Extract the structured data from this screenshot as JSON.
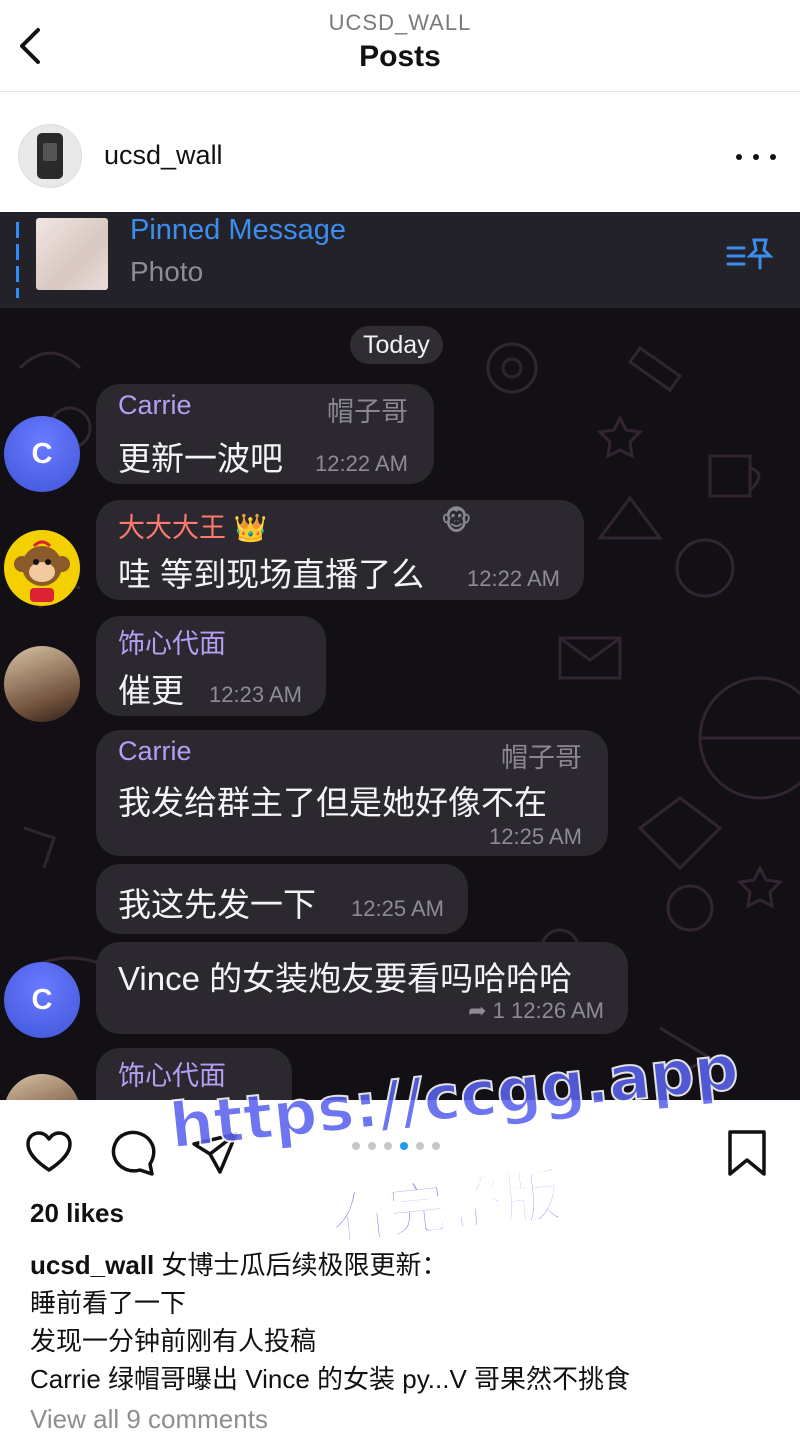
{
  "header": {
    "account": "UCSD_WALL",
    "title": "Posts"
  },
  "post": {
    "username": "ucsd_wall",
    "likes": "20 likes",
    "caption_user": "ucsd_wall",
    "caption_lines": [
      "女博士瓜后续极限更新：",
      "睡前看了一下",
      "发现一分钟前刚有人投稿",
      "Carrie 绿帽哥曝出 Vince 的女装 py...V 哥果然不挑食"
    ],
    "view_all": "View all 9 comments",
    "carousel": {
      "count": 6,
      "active": 3
    }
  },
  "chat": {
    "pinned_title": "Pinned Message",
    "pinned_sub": "Photo",
    "date_label": "Today",
    "messages": [
      {
        "name": "Carrie",
        "tag": "帽子哥",
        "text": "更新一波吧",
        "time": "12:22 AM"
      },
      {
        "name": "大大大王",
        "tag": "🐵",
        "crown": "👑",
        "text": "哇 等到现场直播了么",
        "time": "12:22 AM"
      },
      {
        "name": "饰心代面",
        "text": "催更",
        "time": "12:23 AM"
      },
      {
        "name": "Carrie",
        "tag": "帽子哥",
        "text": "我发给群主了但是她好像不在",
        "time": "12:25 AM"
      },
      {
        "text": "我这先发一下",
        "time": "12:25 AM"
      },
      {
        "text": "Vince 的女装炮友要看吗哈哈哈",
        "reply_count": "1",
        "time": "12:26 AM"
      },
      {
        "name": "饰心代面"
      }
    ],
    "avatar_letter": "C"
  },
  "watermark": {
    "line1": "https://ccgg.app",
    "line2": "看完整版"
  },
  "colors": {
    "chat_bg": "#121014",
    "bubble": "#2b2830",
    "name_purple": "#b59ef2",
    "name_red": "#ff7a6e",
    "pin_blue": "#3b8ef0",
    "carousel_active": "#1d9bf0",
    "watermark": "#5a62ee"
  }
}
